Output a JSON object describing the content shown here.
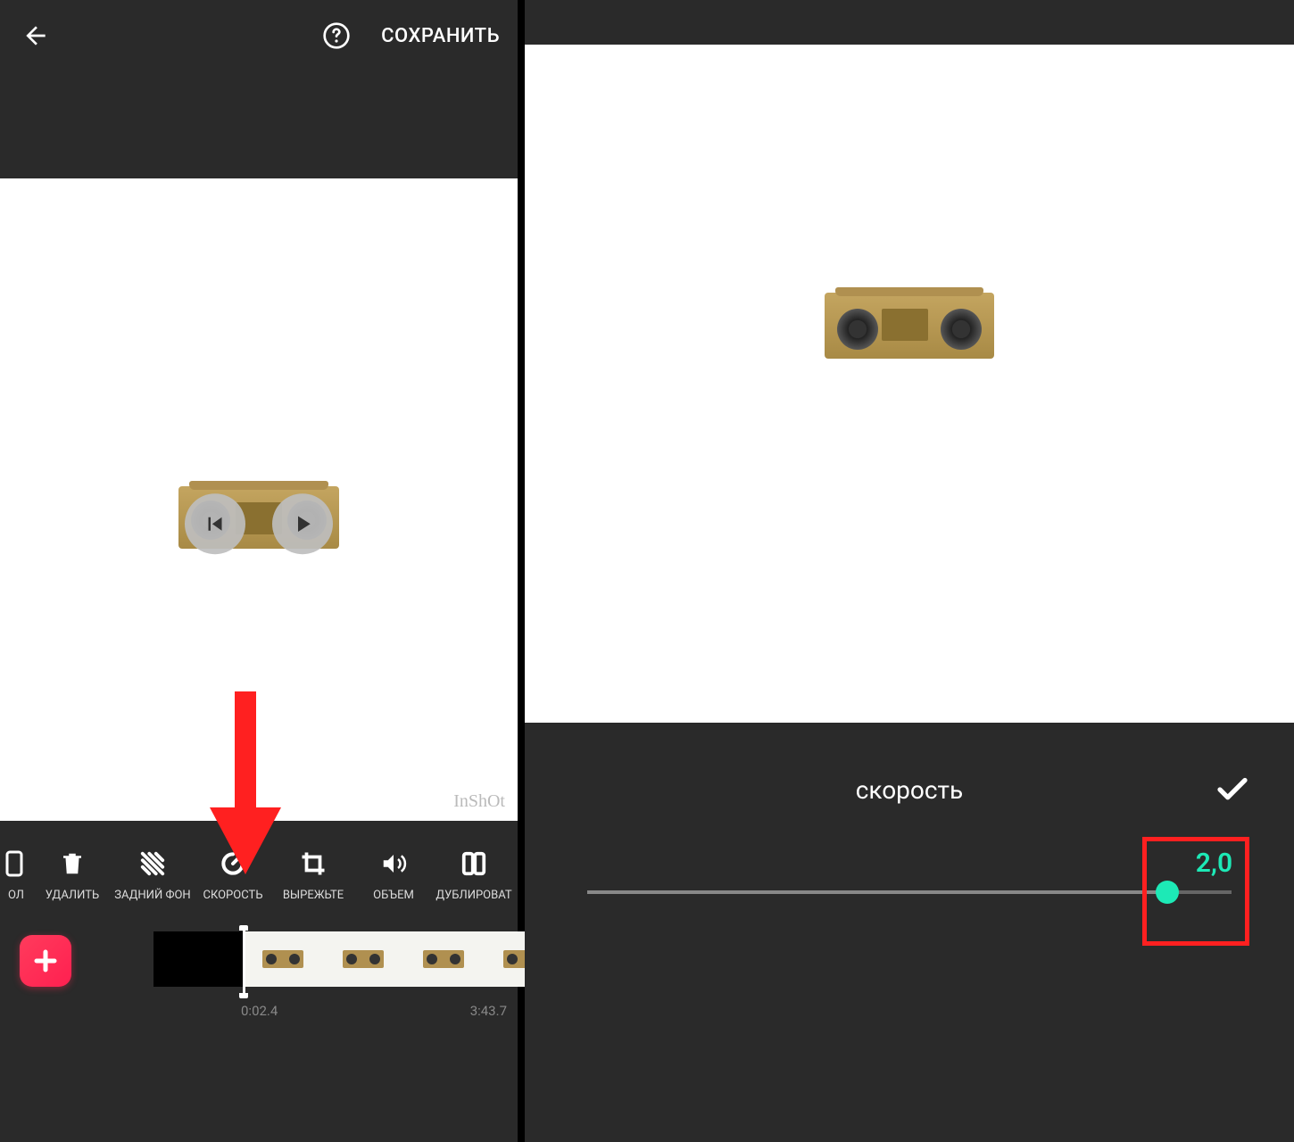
{
  "left": {
    "header": {
      "save_label": "СОХРАНИТЬ"
    },
    "watermark": "InShOt",
    "tools": [
      {
        "id": "precut",
        "label": "ОЛ"
      },
      {
        "id": "delete",
        "label": "УДАЛИТЬ"
      },
      {
        "id": "background",
        "label": "ЗАДНИЙ ФОН"
      },
      {
        "id": "speed",
        "label": "СКОРОСТЬ"
      },
      {
        "id": "crop",
        "label": "ВЫРЕЖЬТЕ"
      },
      {
        "id": "volume",
        "label": "ОБЪЕМ"
      },
      {
        "id": "duplicate",
        "label": "ДУБЛИРОВАТ"
      }
    ],
    "timeline": {
      "current_time": "0:02.4",
      "total_time": "3:43.7"
    }
  },
  "right": {
    "speed_panel": {
      "title": "скорость",
      "value": "2,0",
      "slider_percent": 90
    }
  }
}
